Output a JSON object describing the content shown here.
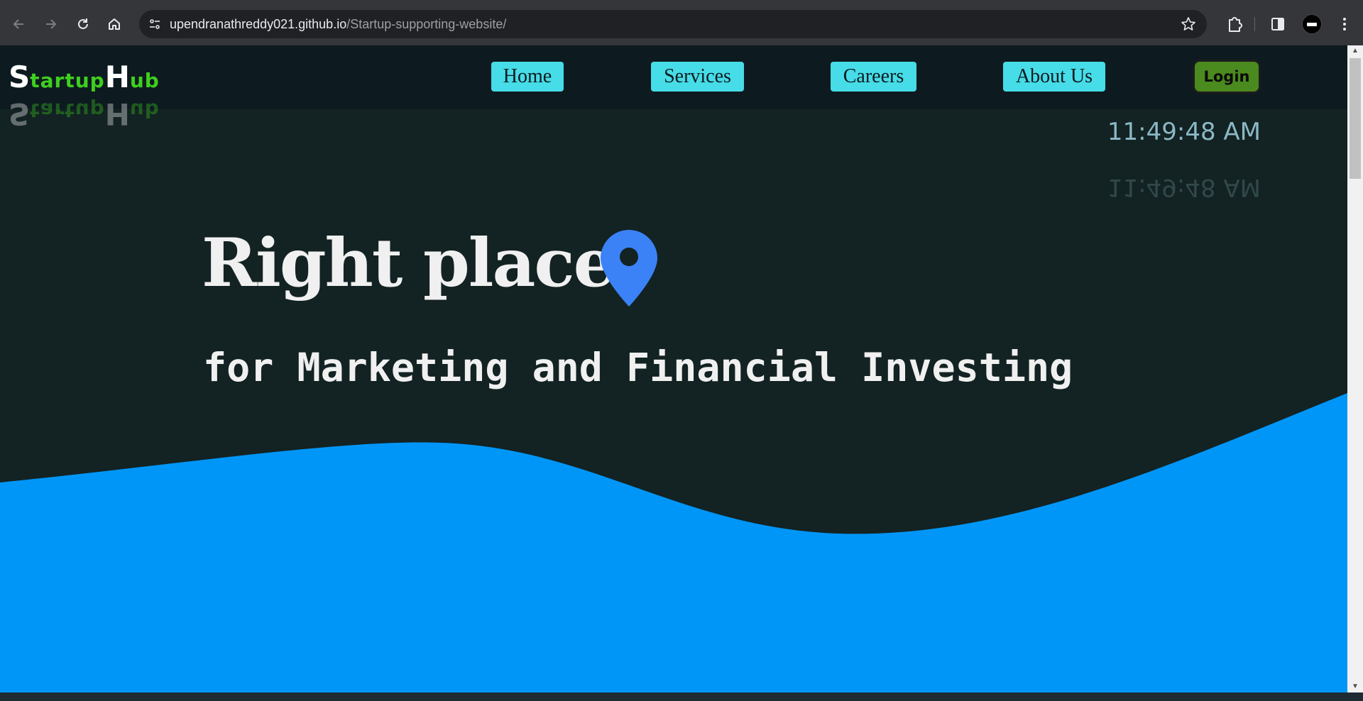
{
  "browser": {
    "url_host": "upendranathreddy021.github.io",
    "url_path": "/Startup-supporting-website/"
  },
  "header": {
    "logo": {
      "s_cap": "S",
      "s_rest": "tartup",
      "h_cap": "H",
      "h_rest": "ub"
    },
    "nav": {
      "home": "Home",
      "services": "Services",
      "careers": "Careers",
      "about": "About Us"
    },
    "login_label": "Login"
  },
  "clock": {
    "time": "11:49:48 AM"
  },
  "hero": {
    "title": "Right place",
    "subtitle": "for Marketing and Financial Investing"
  },
  "colors": {
    "page_bg": "#132222",
    "header_bg": "#0d1a20",
    "nav_button": "#46dce8",
    "login_button": "#4b8a1e",
    "logo_green": "#3ecf1e",
    "wave_blue": "#0096f8",
    "pin_blue": "#3b82f6"
  },
  "icons": {
    "back": "arrow-left-icon",
    "forward": "arrow-right-icon",
    "reload": "reload-icon",
    "home": "home-icon",
    "site_info": "tune-icon",
    "bookmark": "star-icon",
    "extensions": "puzzle-icon",
    "side_panel": "side-panel-icon",
    "menu": "kebab-menu-icon",
    "location": "location-pin-icon"
  }
}
